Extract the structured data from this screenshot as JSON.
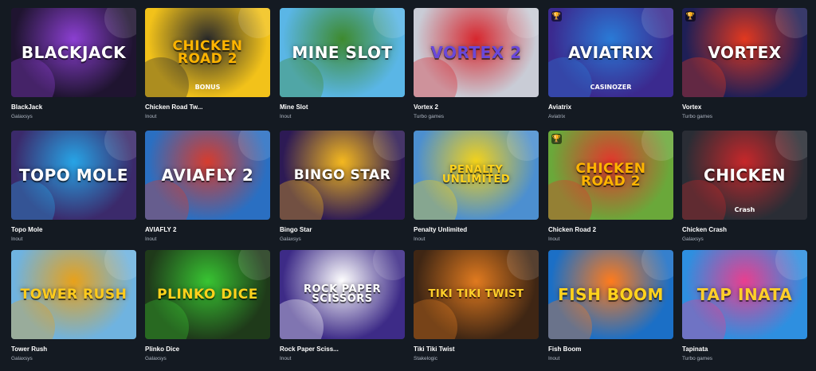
{
  "games": [
    {
      "name": "BlackJack",
      "provider": "Galaxsys",
      "art_text": "BLACKJACK",
      "trophy": false,
      "bg": "#1f1430",
      "accent": "#8b3fd1",
      "text_color": "#ffffff",
      "icon": "cards-icon"
    },
    {
      "name": "Chicken Road Tw...",
      "provider": "Inout",
      "art_text": "CHICKEN ROAD 2",
      "art_sub": "BONUS",
      "trophy": false,
      "bg": "#f2c21a",
      "accent": "#2a2a2a",
      "text_color": "#ffb400",
      "icon": "chicken-icon"
    },
    {
      "name": "Mine Slot",
      "provider": "Inout",
      "art_text": "MINE SLOT",
      "trophy": false,
      "bg": "#5ab6e6",
      "accent": "#3e8a2e",
      "text_color": "#ffffff",
      "icon": "pickaxe-icon"
    },
    {
      "name": "Vortex 2",
      "provider": "Turbo games",
      "art_text": "VORTEX 2",
      "trophy": false,
      "bg": "#c9ccd6",
      "accent": "#d7262d",
      "text_color": "#6a48d9",
      "icon": "vortex-icon"
    },
    {
      "name": "Aviatrix",
      "provider": "Aviatrix",
      "art_text": "Aviatrix",
      "art_sub": "CASINOZER",
      "trophy": true,
      "bg": "#3b2a8f",
      "accent": "#2a7ad6",
      "text_color": "#ffffff",
      "icon": "plane-icon"
    },
    {
      "name": "Vortex",
      "provider": "Turbo games",
      "art_text": "VORTEX",
      "trophy": true,
      "bg": "#1e1f56",
      "accent": "#e2381f",
      "text_color": "#ffffff",
      "icon": "vortex-icon"
    },
    {
      "name": "Topo Mole",
      "provider": "Inout",
      "art_text": "TOPO MOLE",
      "trophy": false,
      "bg": "#3b2a6b",
      "accent": "#27a4e6",
      "text_color": "#ffffff",
      "icon": "mole-icon"
    },
    {
      "name": "AVIAFLY 2",
      "provider": "Inout",
      "art_text": "AVIAFLY 2",
      "trophy": false,
      "bg": "#2a6fc2",
      "accent": "#d63c2e",
      "text_color": "#ffffff",
      "icon": "plane-icon"
    },
    {
      "name": "Bingo Star",
      "provider": "Galaxsys",
      "art_text": "BINGO STAR",
      "trophy": false,
      "bg": "#2d1a55",
      "accent": "#f4b81f",
      "text_color": "#ffffff",
      "icon": "bingo-icon"
    },
    {
      "name": "Penalty Unlimited",
      "provider": "Inout",
      "art_text": "PENALTY UNLIMITED",
      "trophy": false,
      "bg": "#4c8fd0",
      "accent": "#f3d21a",
      "text_color": "#ffd21c",
      "icon": "soccer-icon"
    },
    {
      "name": "Chicken Road 2",
      "provider": "Inout",
      "art_text": "CHICKEN ROAD 2",
      "trophy": true,
      "bg": "#6aa83a",
      "accent": "#e2372c",
      "text_color": "#ffb400",
      "icon": "chicken-icon"
    },
    {
      "name": "Chicken Crash",
      "provider": "Galaxsys",
      "art_text": "CHICKEN",
      "art_sub": "Crash",
      "trophy": false,
      "bg": "#2a2d35",
      "accent": "#c6272a",
      "text_color": "#ffffff",
      "icon": "chicken-icon"
    },
    {
      "name": "Tower Rush",
      "provider": "Galaxsys",
      "art_text": "TOWER RUSH",
      "trophy": false,
      "bg": "#6fb3e0",
      "accent": "#e8a11a",
      "text_color": "#ffcb1c",
      "icon": "tower-icon"
    },
    {
      "name": "Plinko Dice",
      "provider": "Galaxsys",
      "art_text": "Plinko DICE",
      "trophy": false,
      "bg": "#1f3a1a",
      "accent": "#38c432",
      "text_color": "#ffd21c",
      "icon": "dice-icon"
    },
    {
      "name": "Rock Paper Sciss...",
      "provider": "Inout",
      "art_text": "ROCK PAPER SCISSORS",
      "trophy": false,
      "bg": "#3d2b87",
      "accent": "#ffffff",
      "text_color": "#ffffff",
      "icon": "hand-icon"
    },
    {
      "name": "Tiki Tiki Twist",
      "provider": "Stakelogic",
      "art_text": "TiKi TiKi TWIST",
      "trophy": false,
      "bg": "#3f2614",
      "accent": "#e07a1f",
      "text_color": "#ffcf2a",
      "icon": "tiki-icon"
    },
    {
      "name": "Fish Boom",
      "provider": "Inout",
      "art_text": "FISH BOOM",
      "trophy": false,
      "bg": "#1b6fc6",
      "accent": "#ff7b1c",
      "text_color": "#ffd21c",
      "icon": "fish-icon"
    },
    {
      "name": "Tapinata",
      "provider": "Turbo games",
      "art_text": "TAP INATA",
      "trophy": false,
      "bg": "#2e8fe0",
      "accent": "#e83f8f",
      "text_color": "#ffcf2a",
      "icon": "pinata-icon"
    }
  ],
  "trophy_icon": "trophy-icon"
}
